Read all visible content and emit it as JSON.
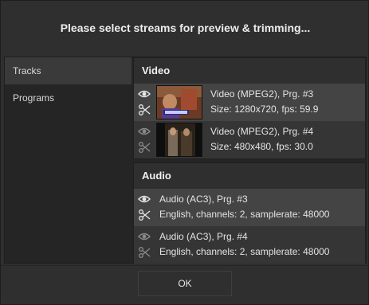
{
  "dialog": {
    "title": "Please select streams for preview & trimming...",
    "ok_label": "OK"
  },
  "sidebar": {
    "items": [
      {
        "label": "Tracks",
        "active": true
      },
      {
        "label": "Programs",
        "active": false
      }
    ]
  },
  "video": {
    "header": "Video",
    "streams": [
      {
        "line1": "Video (MPEG2), Prg. #3",
        "line2": "Size: 1280x720, fps: 59.9",
        "selected": true,
        "icons": [
          "eye-icon",
          "scissors-icon"
        ]
      },
      {
        "line1": "Video (MPEG2), Prg. #4",
        "line2": "Size: 480x480, fps: 30.0",
        "selected": false,
        "icons": [
          "eye-icon",
          "scissors-icon"
        ]
      }
    ]
  },
  "audio": {
    "header": "Audio",
    "streams": [
      {
        "line1": "Audio (AC3), Prg. #3",
        "line2": "English, channels: 2, samplerate: 48000",
        "selected": true,
        "icons": [
          "eye-icon",
          "scissors-icon"
        ]
      },
      {
        "line1": "Audio (AC3), Prg. #4",
        "line2": "English, channels: 2, samplerate: 48000",
        "selected": false,
        "icons": [
          "eye-icon",
          "scissors-icon"
        ]
      }
    ]
  },
  "colors": {
    "background": "#2f2f2f",
    "panel": "#252525",
    "selected_row": "#444444",
    "text": "#e4e4e4"
  }
}
